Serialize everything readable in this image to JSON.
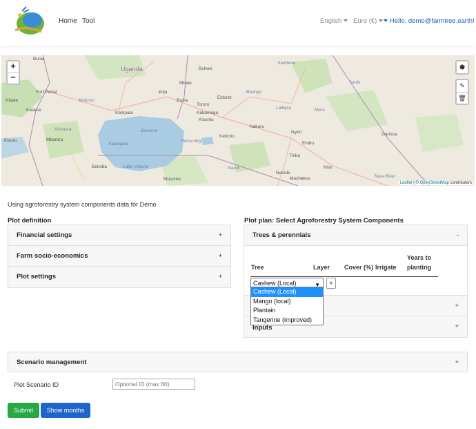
{
  "nav": {
    "links": [
      "Home",
      "Tool"
    ],
    "language": "English",
    "currency": "Euro (€)",
    "user": "Hello, demo@farmtree.earth!"
  },
  "map": {
    "zoom_in": "+",
    "zoom_out": "−",
    "attribution_leaflet": "Leaflet",
    "attribution_sep": " | © ",
    "attribution_osm": "OpenStreetMap",
    "attribution_tail": " contributors",
    "labels": {
      "bunia": "Bunia",
      "uganda": "Uganda",
      "bukwo": "Bukwo",
      "samburu": "Samburu",
      "isiolo": "Isiolo",
      "fort_portal": "Fort Portal",
      "mbale": "Mbale",
      "mukono": "Mukono",
      "jinja": "Jinja",
      "eldoret": "Eldoret",
      "tororo": "Tororo",
      "kampala": "Kampala",
      "busia": "Busia",
      "kakamega": "Kakamega",
      "kisumu": "Kisumu",
      "laikipia": "Laikipia",
      "meru": "Meru",
      "kasese": "Kasese",
      "kiruhura": "Kiruhura",
      "nakuru": "Nakuru",
      "nyeri": "Nyeri",
      "garissa": "Garissa",
      "mbarara": "Mbarara",
      "kalangala": "Kalangala",
      "homa_bay": "Homa Bay",
      "kericho": "Kericho",
      "embu": "Embu",
      "bukoba": "Bukoba",
      "lake_victoria": "Lake Victoria",
      "thika": "Thika",
      "nairobi": "Nairobi",
      "kitui": "Kitui",
      "musoma": "Musoma",
      "narok": "Narok",
      "machakos": "Machakos",
      "tana_river": "Tana River",
      "buvuma": "Buvuma",
      "baringo": "Baringo",
      "kisoro": "Kisoro",
      "kibale": "Kibale"
    }
  },
  "info_text": "Using agroforestry system components data for Demo",
  "plot_definition": {
    "title": "Plot definition",
    "items": [
      {
        "label": "Financial settings",
        "sign": "+"
      },
      {
        "label": "Farm socio-economics",
        "sign": "+"
      },
      {
        "label": "Plot settings",
        "sign": "+"
      }
    ]
  },
  "plot_plan": {
    "title": "Plot plan: Select Agroforestry System Components",
    "trees": {
      "label": "Trees & perennials",
      "sign": "-"
    },
    "columns": [
      "Tree",
      "Layer",
      "Cover (%)",
      "Irrigate",
      "Years to",
      "planting"
    ],
    "selected_tree": "Cashew (Local)",
    "add_label": "+",
    "options": [
      "Cashew (Local)",
      "Mango (local)",
      "Plantain",
      "Tangerine (improved)"
    ],
    "collapsed_sign_1": "+",
    "inputs_label": "Inputs",
    "inputs_sign": "+"
  },
  "scenario": {
    "label": "Scenario management",
    "sign": "+",
    "id_label": "Plot Scenario ID",
    "id_placeholder": "Optional ID (max 60)"
  },
  "buttons": {
    "submit": "Submit",
    "show_months": "Show months"
  }
}
